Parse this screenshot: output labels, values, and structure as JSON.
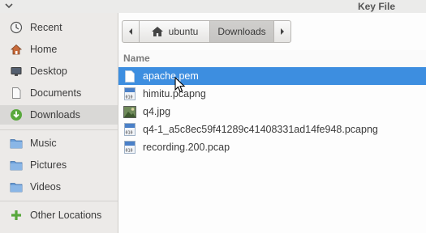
{
  "window": {
    "title": "Key File"
  },
  "sidebar": {
    "items": [
      {
        "label": "Recent",
        "icon": "clock-icon"
      },
      {
        "label": "Home",
        "icon": "home-icon"
      },
      {
        "label": "Desktop",
        "icon": "desktop-icon"
      },
      {
        "label": "Documents",
        "icon": "document-icon"
      },
      {
        "label": "Downloads",
        "icon": "download-icon",
        "selected": true
      },
      {
        "label": "Music",
        "icon": "folder-icon"
      },
      {
        "label": "Pictures",
        "icon": "folder-icon"
      },
      {
        "label": "Videos",
        "icon": "folder-icon"
      },
      {
        "label": "Other Locations",
        "icon": "plus-icon"
      }
    ]
  },
  "pathbar": {
    "home_label": "ubuntu",
    "current_label": "Downloads"
  },
  "file_list": {
    "column_name": "Name",
    "files": [
      {
        "name": "apache.pem",
        "icon": "text-file-icon",
        "selected": true
      },
      {
        "name": "himitu.pcapng",
        "icon": "binary-file-icon"
      },
      {
        "name": "q4.jpg",
        "icon": "image-file-icon"
      },
      {
        "name": "q4-1_a5c8ec59f41289c41408331ad14fe948.pcapng",
        "icon": "binary-file-icon"
      },
      {
        "name": "recording.200.pcap",
        "icon": "binary-file-icon"
      }
    ]
  },
  "colors": {
    "selection": "#3d8ee0",
    "download_green": "#58a83c",
    "folder_blue": "#6a9ed8"
  }
}
